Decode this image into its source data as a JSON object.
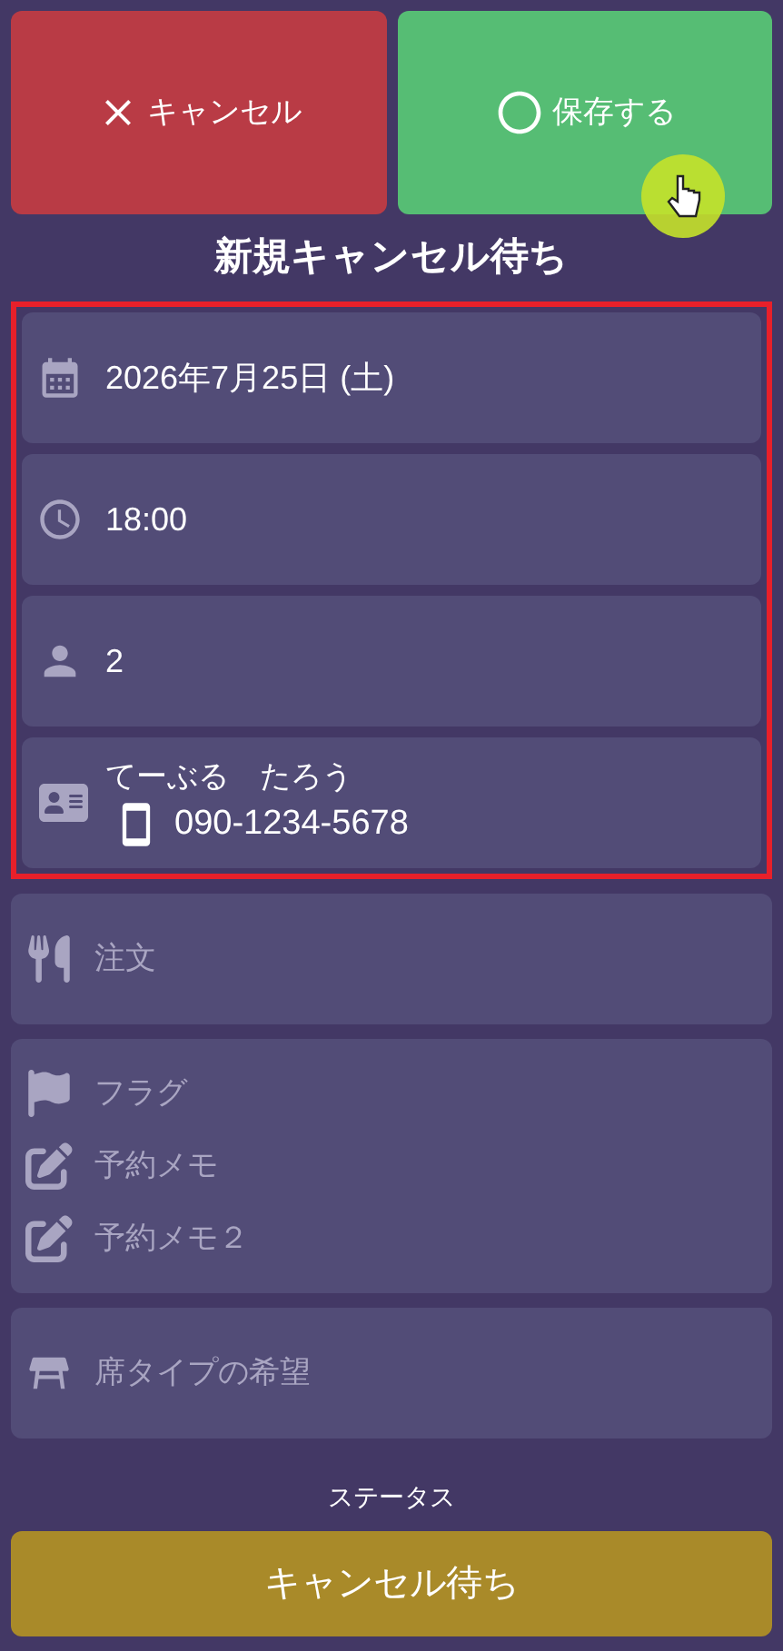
{
  "buttons": [
    {
      "kind": "cancel",
      "label": "キャンセル"
    },
    {
      "kind": "save",
      "label": "保存する"
    }
  ],
  "title": "新規キャンセル待ち",
  "groups": [
    {
      "highlighted": true,
      "cards": [
        {
          "fields": [
            {
              "kind": "date",
              "value": "2026年7月25日 (土)"
            }
          ]
        },
        {
          "fields": [
            {
              "kind": "time",
              "value": "18:00"
            }
          ]
        },
        {
          "fields": [
            {
              "kind": "people",
              "value": "2"
            }
          ]
        },
        {
          "fields": [
            {
              "kind": "customer",
              "name": "てーぶる　たろう",
              "phone": "090-1234-5678"
            }
          ]
        }
      ]
    },
    {
      "highlighted": false,
      "cards": [
        {
          "fields": [
            {
              "kind": "order",
              "placeholder": "注文"
            }
          ]
        },
        {
          "fields": [
            {
              "kind": "flag",
              "placeholder": "フラグ"
            },
            {
              "kind": "memo",
              "placeholder": "予約メモ"
            },
            {
              "kind": "memo",
              "placeholder": "予約メモ２"
            }
          ]
        },
        {
          "fields": [
            {
              "kind": "seat",
              "placeholder": "席タイプの希望"
            }
          ]
        }
      ]
    }
  ],
  "status": {
    "label": "ステータス",
    "value": "キャンセル待ち"
  }
}
